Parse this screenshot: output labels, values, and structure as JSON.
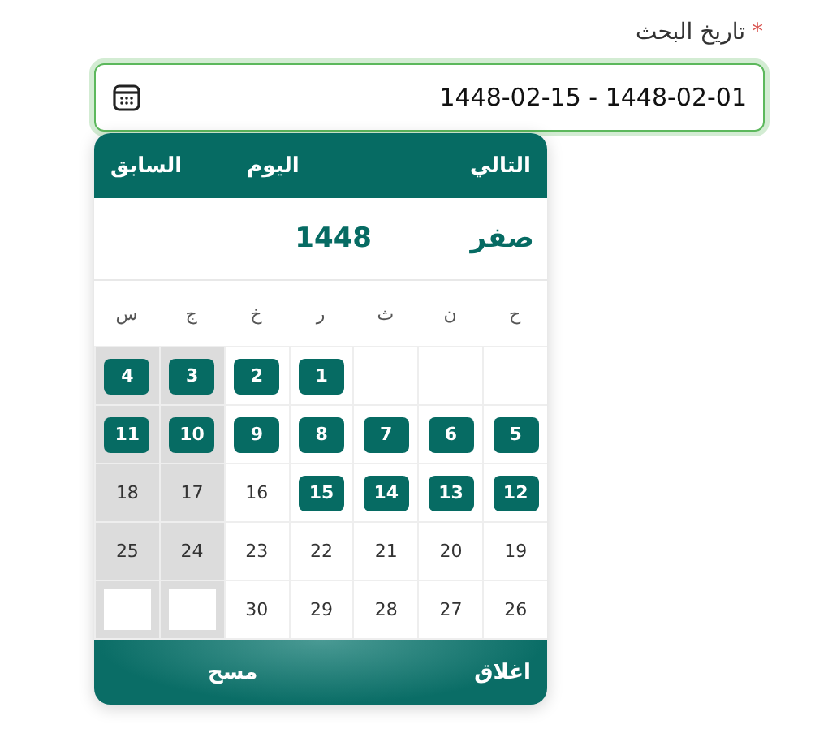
{
  "field": {
    "label": "تاريخ البحث",
    "required_mark": "*",
    "value": "1448-02-15 - 1448-02-01"
  },
  "calendar": {
    "nav": [
      "التالي",
      "اليوم",
      "السابق"
    ],
    "month": "صفر",
    "year": "1448",
    "weekdays": [
      {
        "label": "ح",
        "weekend": false
      },
      {
        "label": "ن",
        "weekend": false
      },
      {
        "label": "ث",
        "weekend": false
      },
      {
        "label": "ر",
        "weekend": false
      },
      {
        "label": "خ",
        "weekend": false
      },
      {
        "label": "ج",
        "weekend": true
      },
      {
        "label": "س",
        "weekend": true
      }
    ],
    "weeks": [
      [
        {
          "kind": "empty"
        },
        {
          "kind": "empty"
        },
        {
          "kind": "empty"
        },
        {
          "kind": "day",
          "day": "1",
          "selected": true
        },
        {
          "kind": "day",
          "day": "2",
          "selected": true
        },
        {
          "kind": "day",
          "day": "3",
          "selected": true
        },
        {
          "kind": "day",
          "day": "4",
          "selected": true
        }
      ],
      [
        {
          "kind": "day",
          "day": "5",
          "selected": true
        },
        {
          "kind": "day",
          "day": "6",
          "selected": true
        },
        {
          "kind": "day",
          "day": "7",
          "selected": true
        },
        {
          "kind": "day",
          "day": "8",
          "selected": true
        },
        {
          "kind": "day",
          "day": "9",
          "selected": true
        },
        {
          "kind": "day",
          "day": "10",
          "selected": true
        },
        {
          "kind": "day",
          "day": "11",
          "selected": true
        }
      ],
      [
        {
          "kind": "day",
          "day": "12",
          "selected": true
        },
        {
          "kind": "day",
          "day": "13",
          "selected": true
        },
        {
          "kind": "day",
          "day": "14",
          "selected": true
        },
        {
          "kind": "day",
          "day": "15",
          "selected": true
        },
        {
          "kind": "day",
          "day": "16",
          "selected": false
        },
        {
          "kind": "day",
          "day": "17",
          "selected": false
        },
        {
          "kind": "day",
          "day": "18",
          "selected": false
        }
      ],
      [
        {
          "kind": "day",
          "day": "19",
          "selected": false
        },
        {
          "kind": "day",
          "day": "20",
          "selected": false
        },
        {
          "kind": "day",
          "day": "21",
          "selected": false
        },
        {
          "kind": "day",
          "day": "22",
          "selected": false
        },
        {
          "kind": "day",
          "day": "23",
          "selected": false
        },
        {
          "kind": "day",
          "day": "24",
          "selected": false
        },
        {
          "kind": "day",
          "day": "25",
          "selected": false
        }
      ],
      [
        {
          "kind": "day",
          "day": "26",
          "selected": false
        },
        {
          "kind": "day",
          "day": "27",
          "selected": false
        },
        {
          "kind": "day",
          "day": "28",
          "selected": false
        },
        {
          "kind": "day",
          "day": "29",
          "selected": false
        },
        {
          "kind": "day",
          "day": "30",
          "selected": false
        },
        {
          "kind": "empty"
        },
        {
          "kind": "empty"
        }
      ]
    ],
    "footer": [
      "اغلاق",
      "مسح"
    ]
  }
}
